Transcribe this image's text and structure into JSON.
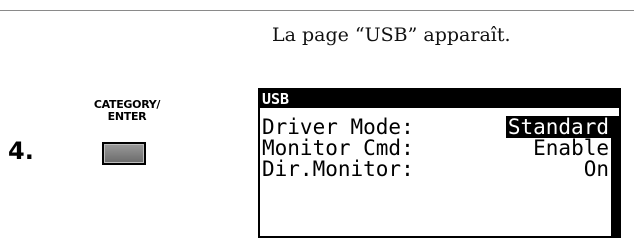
{
  "caption": "La page “USB” apparaît.",
  "step": {
    "number": "4.",
    "button_label_line1": "CATEGORY/",
    "button_label_line2": "ENTER"
  },
  "lcd": {
    "title": "USB",
    "rows": [
      {
        "label": "Driver Mode:",
        "value": "Standard",
        "selected": true
      },
      {
        "label": "Monitor Cmd:",
        "value": "Enable",
        "selected": false
      },
      {
        "label": "Dir.Monitor:",
        "value": "On",
        "selected": false
      }
    ]
  }
}
